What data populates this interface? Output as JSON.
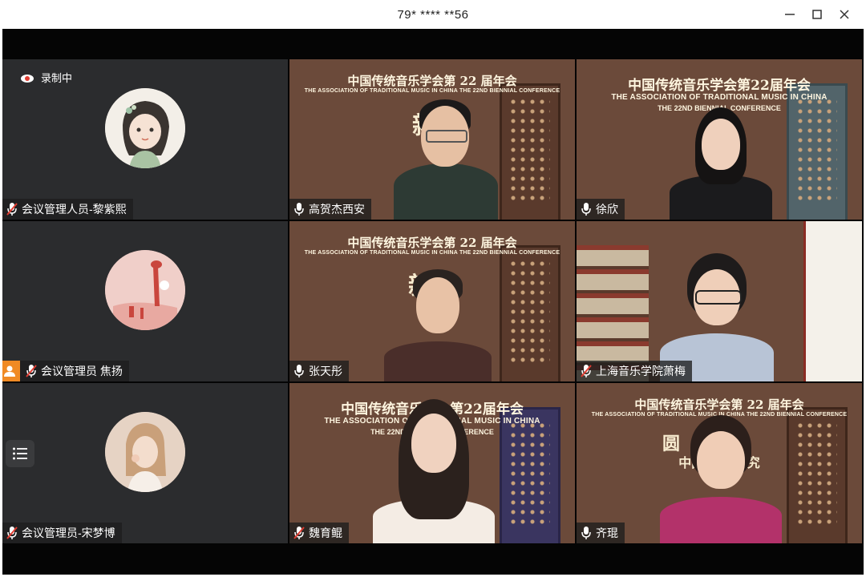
{
  "window": {
    "title": "79* **** **56",
    "controls": {
      "minimize_icon": "minimize-icon",
      "maximize_icon": "maximize-icon",
      "close_icon": "close-icon"
    }
  },
  "meeting": {
    "recording_label": "录制中",
    "banner": {
      "cn_title": "中国传统音乐学会第 22 届年会",
      "cn_title_alt": "中国传统音乐学会第22届年会",
      "en_line1": "THE ASSOCIATION OF TRADITIONAL MUSIC IN CHINA THE 22ND BIENNIAL CONFERENCE",
      "en_line_a": "THE ASSOCIATION OF TRADITIONAL MUSIC IN CHINA",
      "en_line_b": "THE 22ND BIENNIAL CONFERENCE",
      "overlay_1": "新",
      "overlay_2": "新究",
      "overlay_3": "圆",
      "overlay_4": "中国古典 研究"
    },
    "participants": [
      {
        "name": "会议管理人员-黎紫熙",
        "mic": "muted",
        "type": "avatar"
      },
      {
        "name": "高贺杰西安",
        "mic": "on",
        "type": "video"
      },
      {
        "name": "徐欣",
        "mic": "on",
        "type": "video"
      },
      {
        "name": "会议管理员 焦扬",
        "mic": "muted",
        "type": "avatar"
      },
      {
        "name": "张天彤",
        "mic": "on",
        "type": "video"
      },
      {
        "name": "上海音乐学院萧梅",
        "mic": "muted",
        "type": "video"
      },
      {
        "name": "会议管理员-宋梦博",
        "mic": "muted",
        "type": "avatar"
      },
      {
        "name": "魏育鲲",
        "mic": "muted",
        "type": "video"
      },
      {
        "name": "齐琨",
        "mic": "on",
        "type": "video"
      }
    ]
  },
  "colors": {
    "tile_bg": "#2b2c2e",
    "stage_bg": "#050505",
    "user_badge": "#f08a24"
  }
}
